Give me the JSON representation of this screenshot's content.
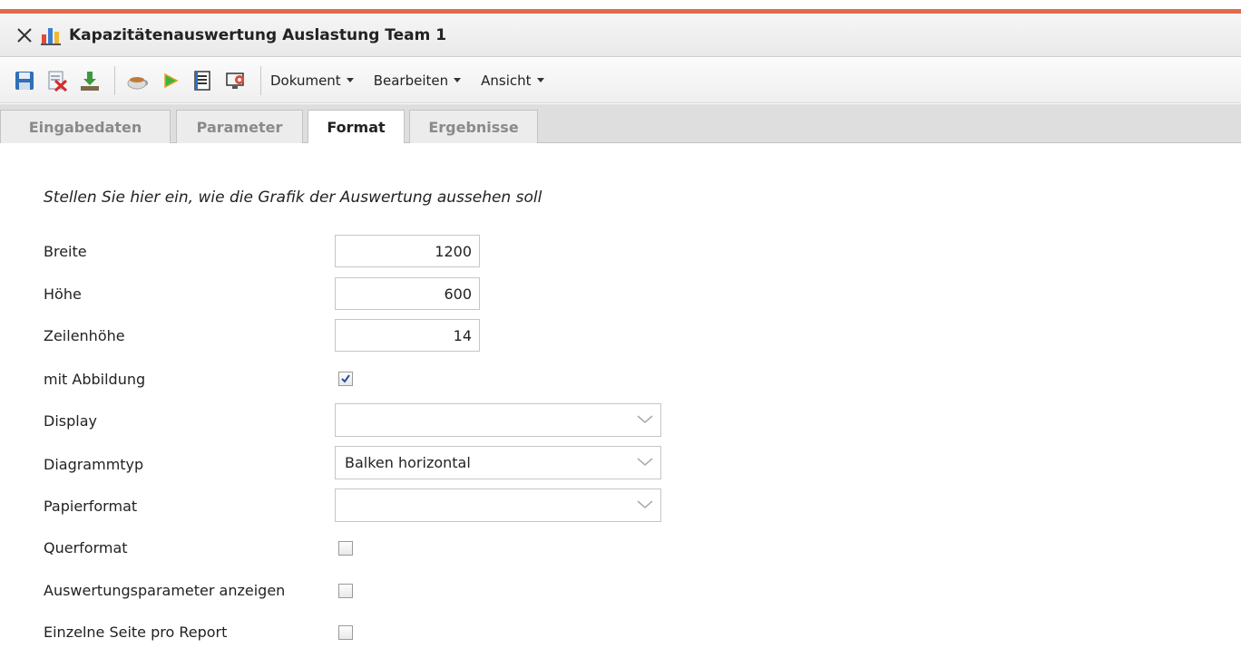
{
  "window": {
    "title": "Kapazitätenauswertung Auslastung Team 1",
    "close_icon": "close-icon",
    "app_icon": "bar-chart-icon",
    "accent_color": "#e06a4e"
  },
  "toolbar": {
    "icons": [
      "save-icon",
      "delete-document-icon",
      "download-icon",
      "coffee-cup-icon",
      "play-arrow-icon",
      "list-document-icon",
      "monitor-settings-icon"
    ],
    "menus": [
      "Dokument",
      "Bearbeiten",
      "Ansicht"
    ]
  },
  "tabs": [
    {
      "label": "Eingabedaten",
      "active": false
    },
    {
      "label": "Parameter",
      "active": false
    },
    {
      "label": "Format",
      "active": true
    },
    {
      "label": "Ergebnisse",
      "active": false
    }
  ],
  "form": {
    "hint": "Stellen Sie hier ein, wie die Grafik der Auswertung aussehen soll",
    "breite": {
      "label": "Breite",
      "value": "1200"
    },
    "hoehe": {
      "label": "Höhe",
      "value": "600"
    },
    "zeilenhoehe": {
      "label": "Zeilenhöhe",
      "value": "14"
    },
    "mit_abbildung": {
      "label": "mit Abbildung",
      "checked": true
    },
    "display": {
      "label": "Display",
      "value": ""
    },
    "diagrammtyp": {
      "label": "Diagrammtyp",
      "value": "Balken horizontal"
    },
    "papierformat": {
      "label": "Papierformat",
      "value": ""
    },
    "querformat": {
      "label": "Querformat",
      "checked": false
    },
    "auswertungsparameter": {
      "label": "Auswertungsparameter anzeigen",
      "checked": false
    },
    "einzelne_seite": {
      "label": "Einzelne Seite pro Report",
      "checked": false
    }
  }
}
